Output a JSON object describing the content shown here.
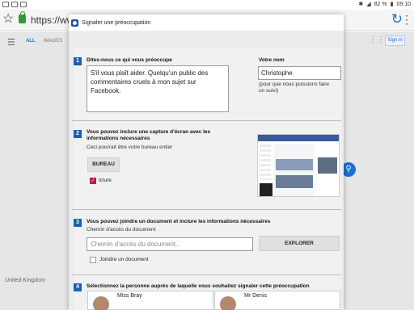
{
  "status_bar": {
    "battery": "82 %",
    "time": "09:10"
  },
  "browser": {
    "url": "https://www"
  },
  "background_page": {
    "tab_all": "ALL",
    "tab_images": "IMAGES",
    "sign_in": "Sign in",
    "country": "United Kingdom"
  },
  "dialog": {
    "title": "Signaler une préoccupation",
    "section1": {
      "number": "1",
      "label": "Dites-nous ce qui vous préoccupe",
      "text": "S'il vous plaît aider. Quelqu'un public des commentaires cruels à mon sujet sur Facebook.",
      "name_label": "Votre nom",
      "name_value": "Christophe",
      "name_hint": "(pour que nous puissions faire un suivi)"
    },
    "section2": {
      "number": "2",
      "label": "Vous pouvez inclure une capture d'écran avec les informations nécessaires",
      "sub": "Ceci pourrait être votre bureau entier",
      "button": "BUREAU",
      "checkbox_label": "Iclure",
      "checked": true
    },
    "section3": {
      "number": "3",
      "label": "Vous pouvez joindre un document et inclure les informations nécessaires",
      "sub": "Chemin d'accès du document",
      "placeholder": "Chemin d'accès du document..",
      "button": "EXPLORER",
      "checkbox_label": "Joindre un document",
      "checked": false
    },
    "section4": {
      "number": "4",
      "label": "Sélectionnez la personne auprès de laquelle vous souhaitez signaler cette préoccupation",
      "people": [
        "Miss Bray",
        "Mr Denis"
      ]
    }
  }
}
